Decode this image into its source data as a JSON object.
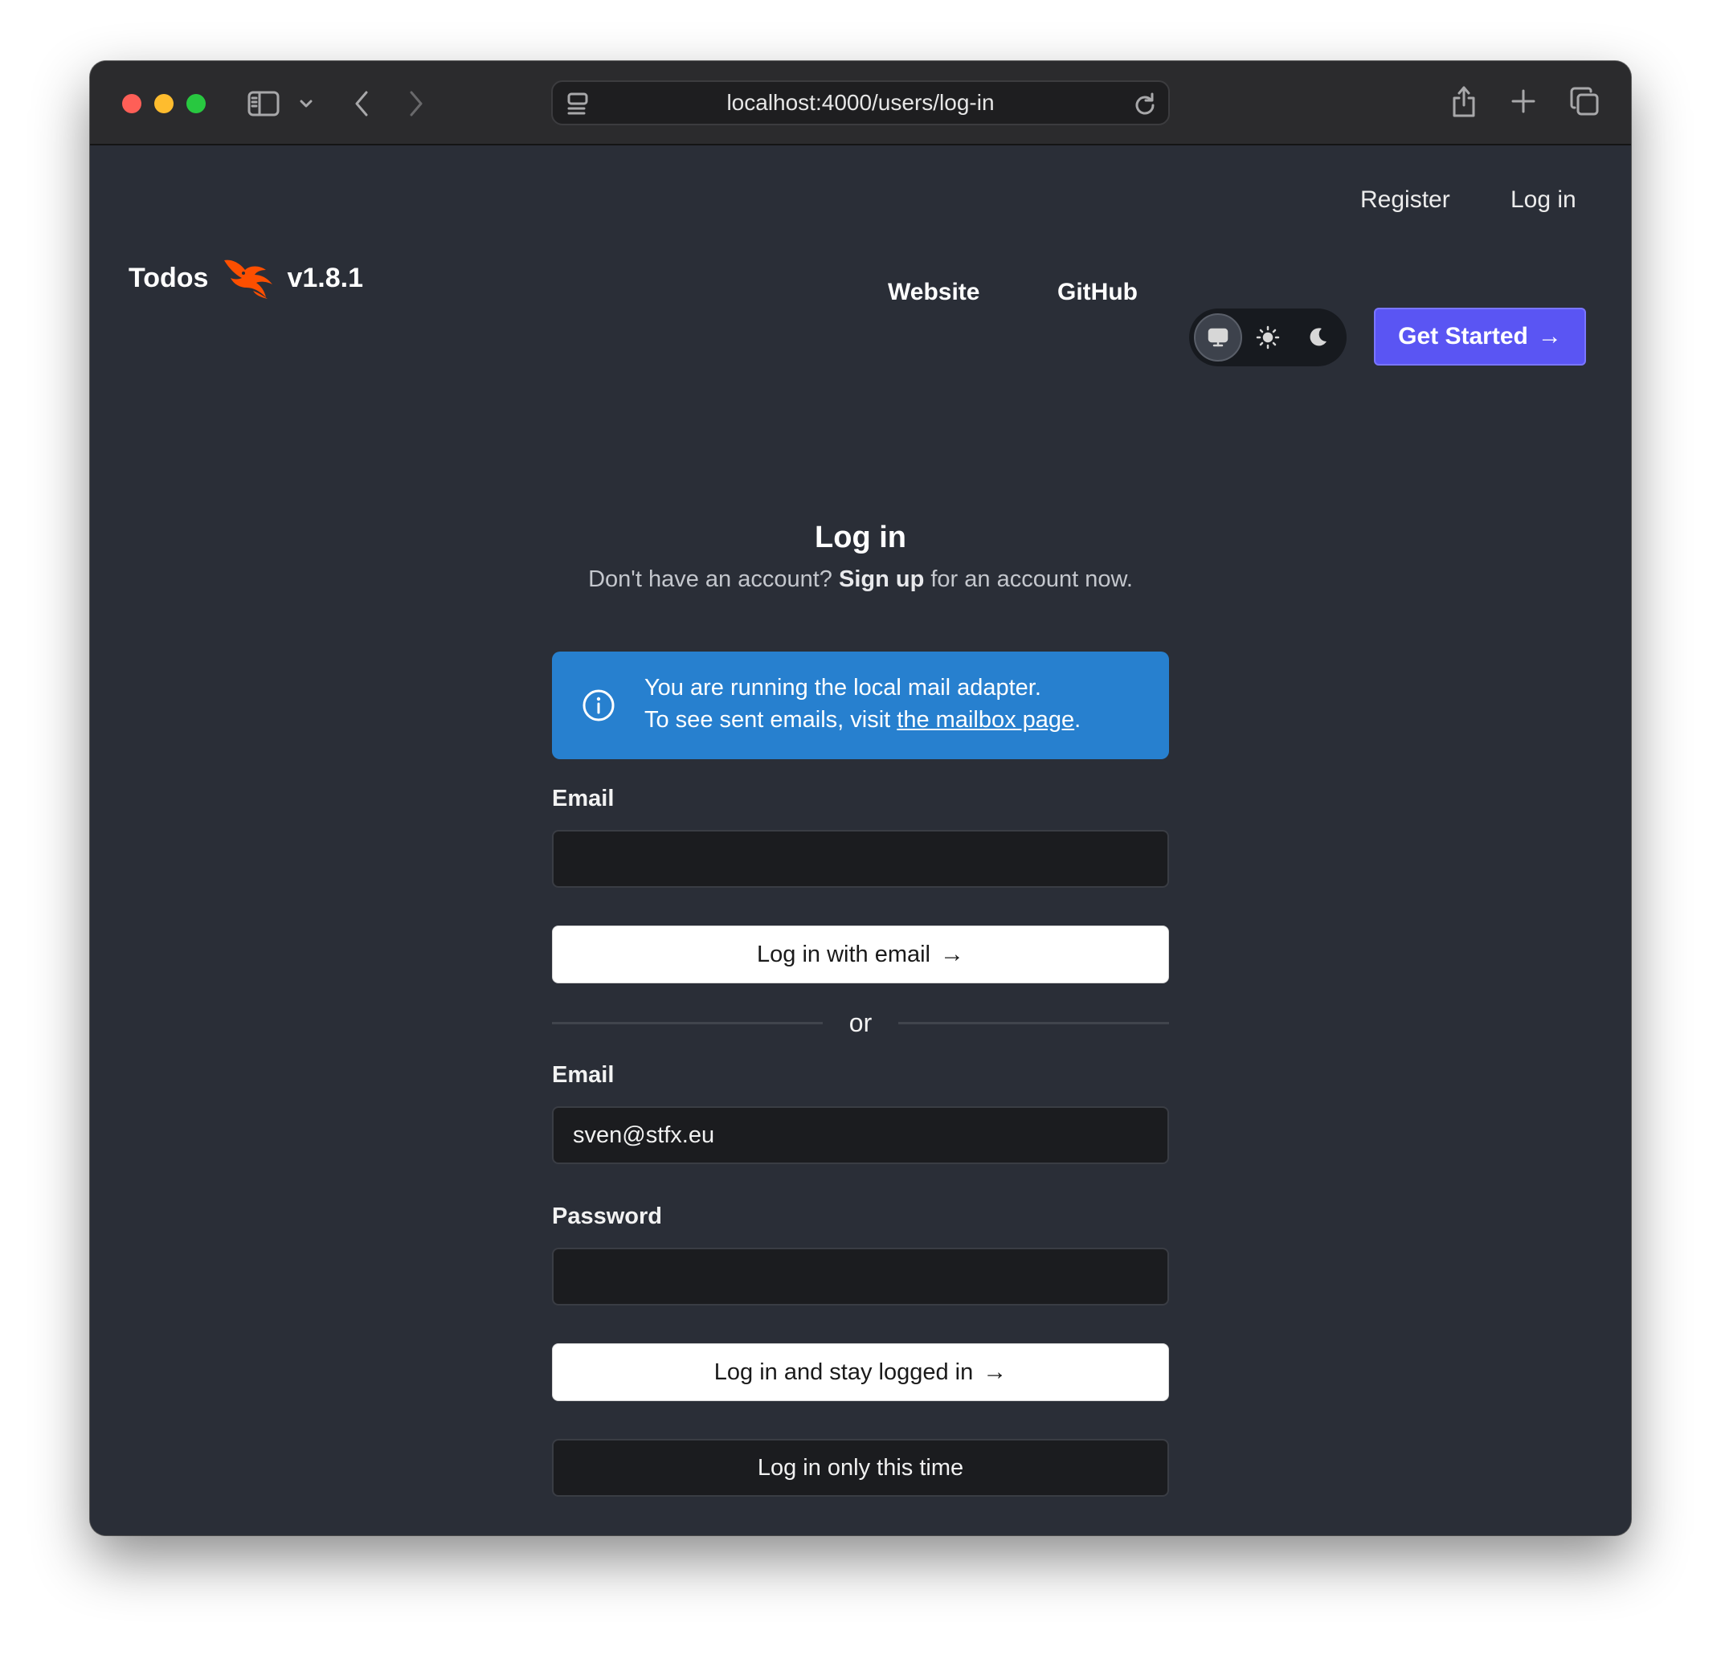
{
  "browser": {
    "url": "localhost:4000/users/log-in"
  },
  "header": {
    "register_label": "Register",
    "login_label": "Log in",
    "brand_title": "Todos",
    "version": "v1.8.1",
    "nav_website": "Website",
    "nav_github": "GitHub",
    "theme_options": [
      "system",
      "light",
      "dark"
    ],
    "theme_selected": "system",
    "get_started_label": "Get Started",
    "accent_color": "#5a55f3"
  },
  "login": {
    "title": "Log in",
    "subtitle_prefix": "Don't have an account?",
    "signup_link": "Sign up",
    "subtitle_suffix": "for an account now.",
    "alert_line1": "You are running the local mail adapter.",
    "alert_line2_prefix": "To see sent emails, visit",
    "alert_link": "the mailbox page",
    "alert_line2_suffix": ".",
    "alert_color": "#2780cf",
    "magic_email_label": "Email",
    "magic_email_value": "",
    "magic_button": "Log in with email",
    "or_text": "or",
    "password_email_label": "Email",
    "password_email_value": "sven@stfx.eu",
    "password_label": "Password",
    "password_value": "",
    "stay_logged_in_button": "Log in and stay logged in",
    "only_this_time_button": "Log in only this time"
  }
}
